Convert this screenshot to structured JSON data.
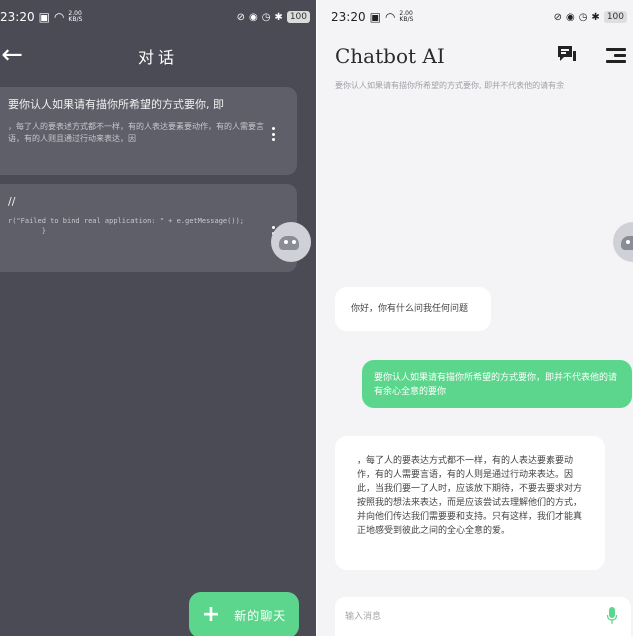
{
  "left": {
    "status": {
      "time": "23:20",
      "speed": "2.00\nKB/S",
      "battery": "100"
    },
    "title": "对话",
    "conversations": [
      {
        "heading": "要你认人如果请有描你所希望的方式要你, 即",
        "body": "，每了人的要表述方式都不一样，有的人表达要素要动作，有的人需要言语，有的人则且通过行动来表达，因"
      },
      {
        "heading": "//",
        "body": "r(\"Failed to bind real application: \" + e.getMessage());\n        }"
      }
    ],
    "new_chat_label": "新的聊天"
  },
  "right": {
    "status": {
      "time": "23:20",
      "speed": "2.00\nKB/S",
      "battery": "100"
    },
    "title": "Chatbot AI",
    "subtitle": "要你认人如果请有描你所希望的方式要你, 即并不代表他的请有余",
    "messages": [
      {
        "role": "bot",
        "text": "你好，你有什么问我任何问题"
      },
      {
        "role": "user",
        "text": "要你认人如果请有描你所希望的方式要你，即并不代表他的请有余心全意的要你"
      },
      {
        "role": "bot",
        "text": "，每了人的要表达方式都不一样，有的人表达要素要动作，有的人需要言语，有的人则是通过行动来表达。因此，当我们要一了人时，应该放下期待，不要去要求对方按照我的想法来表达，而是应该尝试去理解他们的方式，并向他们传达我们需要要和支持。只有这样，我们才能真正地感受到彼此之间的全心全意的爱。"
      }
    ],
    "input_placeholder": "输入消息"
  },
  "colors": {
    "accent": "#5cd68c",
    "dark_bg": "#4a4b55",
    "card_bg": "#5e5f69",
    "light_bg": "#f4f4f6"
  }
}
